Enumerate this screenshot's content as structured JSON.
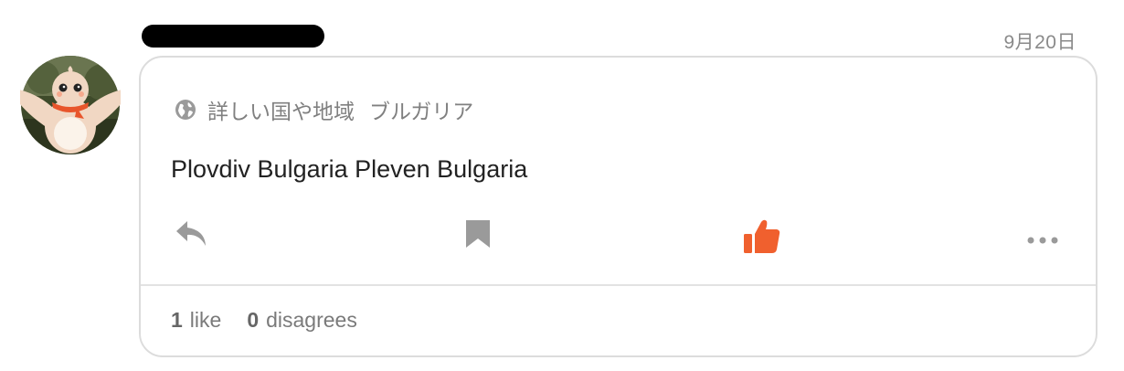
{
  "post": {
    "date": "9月20日",
    "category_label": "詳しい国や地域",
    "category_value": "ブルガリア",
    "content": "Plovdiv Bulgaria Pleven Bulgaria",
    "like_count": "1",
    "like_label": "like",
    "disagree_count": "0",
    "disagree_label": "disagrees"
  },
  "colors": {
    "accent": "#f0602e",
    "icon_gray": "#9a9a9a",
    "border": "#dcdcdc"
  },
  "icons": {
    "category": "globe-icon",
    "reply": "reply-icon",
    "bookmark": "bookmark-icon",
    "like": "thumbs-up-icon",
    "more": "more-icon"
  }
}
